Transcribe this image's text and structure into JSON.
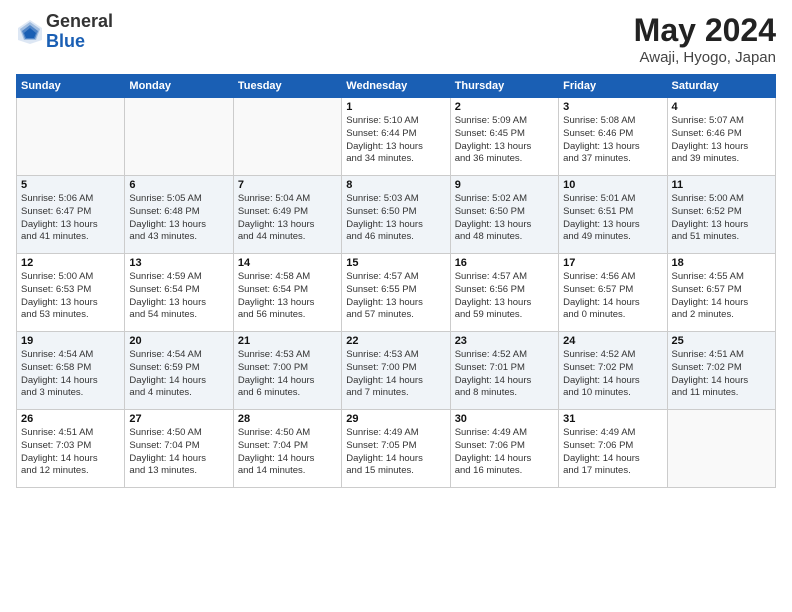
{
  "header": {
    "logo_general": "General",
    "logo_blue": "Blue",
    "title": "May 2024",
    "location": "Awaji, Hyogo, Japan"
  },
  "days_of_week": [
    "Sunday",
    "Monday",
    "Tuesday",
    "Wednesday",
    "Thursday",
    "Friday",
    "Saturday"
  ],
  "weeks": [
    [
      {
        "day": "",
        "info": ""
      },
      {
        "day": "",
        "info": ""
      },
      {
        "day": "",
        "info": ""
      },
      {
        "day": "1",
        "info": "Sunrise: 5:10 AM\nSunset: 6:44 PM\nDaylight: 13 hours\nand 34 minutes."
      },
      {
        "day": "2",
        "info": "Sunrise: 5:09 AM\nSunset: 6:45 PM\nDaylight: 13 hours\nand 36 minutes."
      },
      {
        "day": "3",
        "info": "Sunrise: 5:08 AM\nSunset: 6:46 PM\nDaylight: 13 hours\nand 37 minutes."
      },
      {
        "day": "4",
        "info": "Sunrise: 5:07 AM\nSunset: 6:46 PM\nDaylight: 13 hours\nand 39 minutes."
      }
    ],
    [
      {
        "day": "5",
        "info": "Sunrise: 5:06 AM\nSunset: 6:47 PM\nDaylight: 13 hours\nand 41 minutes."
      },
      {
        "day": "6",
        "info": "Sunrise: 5:05 AM\nSunset: 6:48 PM\nDaylight: 13 hours\nand 43 minutes."
      },
      {
        "day": "7",
        "info": "Sunrise: 5:04 AM\nSunset: 6:49 PM\nDaylight: 13 hours\nand 44 minutes."
      },
      {
        "day": "8",
        "info": "Sunrise: 5:03 AM\nSunset: 6:50 PM\nDaylight: 13 hours\nand 46 minutes."
      },
      {
        "day": "9",
        "info": "Sunrise: 5:02 AM\nSunset: 6:50 PM\nDaylight: 13 hours\nand 48 minutes."
      },
      {
        "day": "10",
        "info": "Sunrise: 5:01 AM\nSunset: 6:51 PM\nDaylight: 13 hours\nand 49 minutes."
      },
      {
        "day": "11",
        "info": "Sunrise: 5:00 AM\nSunset: 6:52 PM\nDaylight: 13 hours\nand 51 minutes."
      }
    ],
    [
      {
        "day": "12",
        "info": "Sunrise: 5:00 AM\nSunset: 6:53 PM\nDaylight: 13 hours\nand 53 minutes."
      },
      {
        "day": "13",
        "info": "Sunrise: 4:59 AM\nSunset: 6:54 PM\nDaylight: 13 hours\nand 54 minutes."
      },
      {
        "day": "14",
        "info": "Sunrise: 4:58 AM\nSunset: 6:54 PM\nDaylight: 13 hours\nand 56 minutes."
      },
      {
        "day": "15",
        "info": "Sunrise: 4:57 AM\nSunset: 6:55 PM\nDaylight: 13 hours\nand 57 minutes."
      },
      {
        "day": "16",
        "info": "Sunrise: 4:57 AM\nSunset: 6:56 PM\nDaylight: 13 hours\nand 59 minutes."
      },
      {
        "day": "17",
        "info": "Sunrise: 4:56 AM\nSunset: 6:57 PM\nDaylight: 14 hours\nand 0 minutes."
      },
      {
        "day": "18",
        "info": "Sunrise: 4:55 AM\nSunset: 6:57 PM\nDaylight: 14 hours\nand 2 minutes."
      }
    ],
    [
      {
        "day": "19",
        "info": "Sunrise: 4:54 AM\nSunset: 6:58 PM\nDaylight: 14 hours\nand 3 minutes."
      },
      {
        "day": "20",
        "info": "Sunrise: 4:54 AM\nSunset: 6:59 PM\nDaylight: 14 hours\nand 4 minutes."
      },
      {
        "day": "21",
        "info": "Sunrise: 4:53 AM\nSunset: 7:00 PM\nDaylight: 14 hours\nand 6 minutes."
      },
      {
        "day": "22",
        "info": "Sunrise: 4:53 AM\nSunset: 7:00 PM\nDaylight: 14 hours\nand 7 minutes."
      },
      {
        "day": "23",
        "info": "Sunrise: 4:52 AM\nSunset: 7:01 PM\nDaylight: 14 hours\nand 8 minutes."
      },
      {
        "day": "24",
        "info": "Sunrise: 4:52 AM\nSunset: 7:02 PM\nDaylight: 14 hours\nand 10 minutes."
      },
      {
        "day": "25",
        "info": "Sunrise: 4:51 AM\nSunset: 7:02 PM\nDaylight: 14 hours\nand 11 minutes."
      }
    ],
    [
      {
        "day": "26",
        "info": "Sunrise: 4:51 AM\nSunset: 7:03 PM\nDaylight: 14 hours\nand 12 minutes."
      },
      {
        "day": "27",
        "info": "Sunrise: 4:50 AM\nSunset: 7:04 PM\nDaylight: 14 hours\nand 13 minutes."
      },
      {
        "day": "28",
        "info": "Sunrise: 4:50 AM\nSunset: 7:04 PM\nDaylight: 14 hours\nand 14 minutes."
      },
      {
        "day": "29",
        "info": "Sunrise: 4:49 AM\nSunset: 7:05 PM\nDaylight: 14 hours\nand 15 minutes."
      },
      {
        "day": "30",
        "info": "Sunrise: 4:49 AM\nSunset: 7:06 PM\nDaylight: 14 hours\nand 16 minutes."
      },
      {
        "day": "31",
        "info": "Sunrise: 4:49 AM\nSunset: 7:06 PM\nDaylight: 14 hours\nand 17 minutes."
      },
      {
        "day": "",
        "info": ""
      }
    ]
  ]
}
